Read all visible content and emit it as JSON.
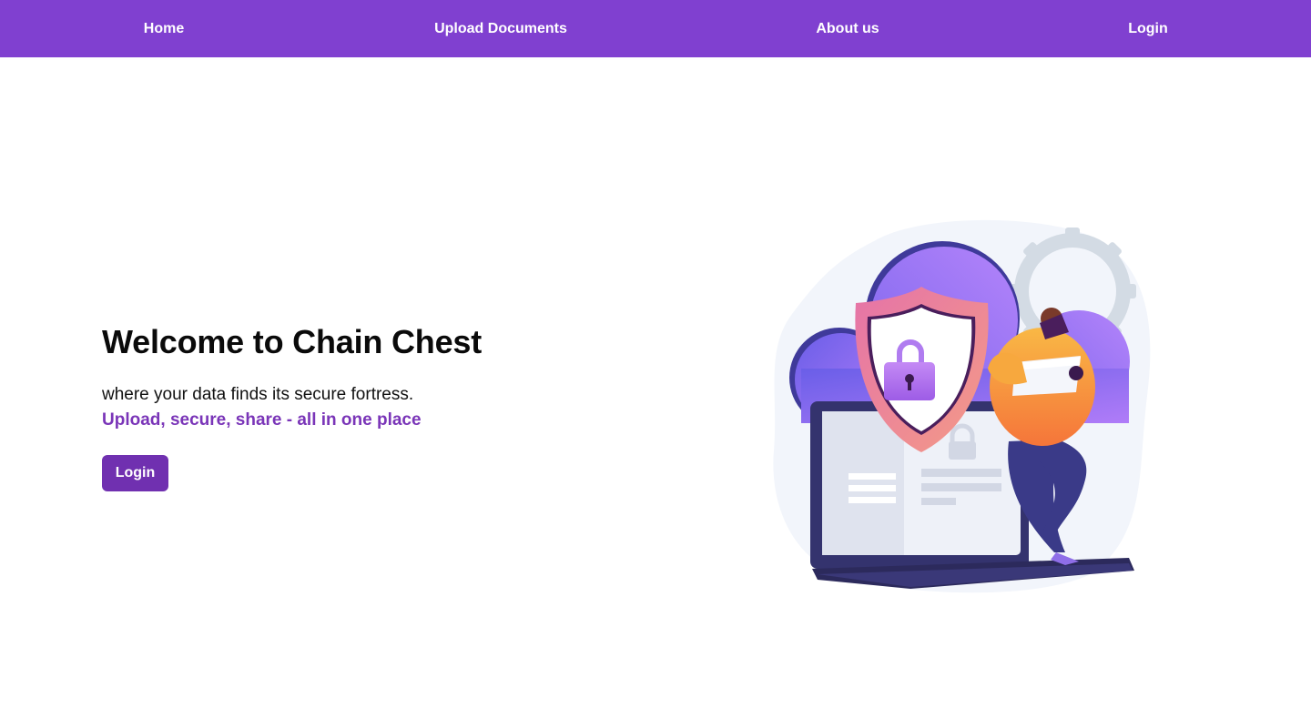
{
  "nav": {
    "home": "Home",
    "upload": "Upload Documents",
    "about": "About us",
    "login": "Login"
  },
  "hero": {
    "title": "Welcome to Chain Chest",
    "subtitle": "where your data finds its secure fortress.",
    "tagline": "Upload, secure, share - all in one place",
    "login_button": "Login"
  },
  "illustration": {
    "icons": [
      "cloud-icon",
      "gear-icon",
      "shield-icon",
      "padlock-icon",
      "laptop-icon",
      "person-figure"
    ]
  },
  "colors": {
    "nav_bg": "#8040d0",
    "accent": "#7a35b8",
    "button_bg": "#7030b0",
    "text": "#0a0a0a"
  }
}
